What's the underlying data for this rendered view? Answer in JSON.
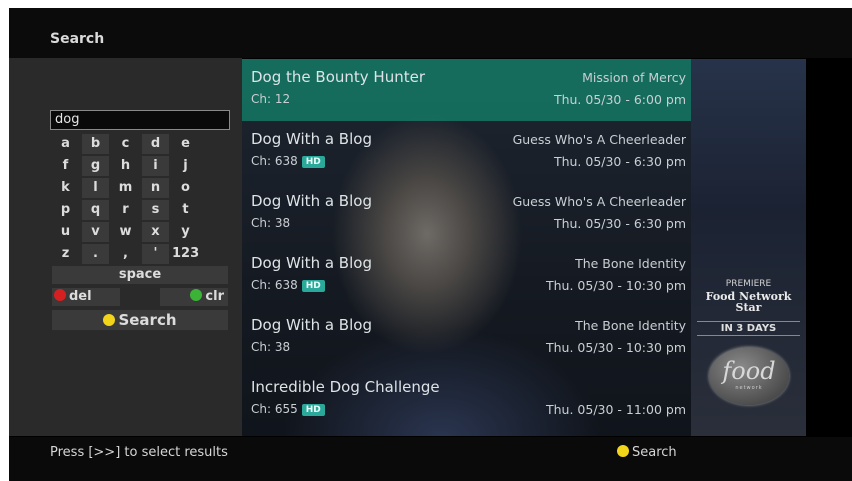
{
  "header": {
    "title": "Search"
  },
  "search": {
    "query": "dog"
  },
  "keyboard": {
    "rows": [
      [
        "a",
        "b",
        "c",
        "d",
        "e"
      ],
      [
        "f",
        "g",
        "h",
        "i",
        "j"
      ],
      [
        "k",
        "l",
        "m",
        "n",
        "o"
      ],
      [
        "p",
        "q",
        "r",
        "s",
        "t"
      ],
      [
        "u",
        "v",
        "w",
        "x",
        "y"
      ],
      [
        "z",
        ".",
        ",",
        "'",
        "123"
      ]
    ],
    "space_label": "space",
    "del_label": "del",
    "clr_label": "clr",
    "search_label": "Search"
  },
  "colors": {
    "red": "#d42020",
    "green": "#3bb336",
    "yellow": "#f2d41a",
    "accent": "#14786a"
  },
  "results": [
    {
      "title": "Dog the Bounty Hunter",
      "episode": "Mission of Mercy",
      "channel": "Ch: 12",
      "hd": false,
      "datetime": "Thu. 05/30 - 6:00 pm",
      "selected": true
    },
    {
      "title": "Dog With a Blog",
      "episode": "Guess Who's A Cheerleader",
      "channel": "Ch: 638",
      "hd": true,
      "datetime": "Thu. 05/30 - 6:30 pm",
      "selected": false
    },
    {
      "title": "Dog With a Blog",
      "episode": "Guess Who's A Cheerleader",
      "channel": "Ch: 38",
      "hd": false,
      "datetime": "Thu. 05/30 - 6:30 pm",
      "selected": false
    },
    {
      "title": "Dog With a Blog",
      "episode": "The Bone Identity",
      "channel": "Ch: 638",
      "hd": true,
      "datetime": "Thu. 05/30 - 10:30 pm",
      "selected": false
    },
    {
      "title": "Dog With a Blog",
      "episode": "The Bone Identity",
      "channel": "Ch: 38",
      "hd": false,
      "datetime": "Thu. 05/30 - 10:30 pm",
      "selected": false
    },
    {
      "title": "Incredible Dog Challenge",
      "episode": "",
      "channel": "Ch: 655",
      "hd": true,
      "datetime": "Thu. 05/30 - 11:00 pm",
      "selected": false
    }
  ],
  "hd_badge": "HD",
  "ad": {
    "premiere": "PREMIERE",
    "show": "Food Network Star",
    "when": "IN 3 DAYS",
    "logo": "food",
    "logo_sub": "network"
  },
  "footer": {
    "hint": "Press [>>] to select results",
    "search_label": "Search"
  }
}
